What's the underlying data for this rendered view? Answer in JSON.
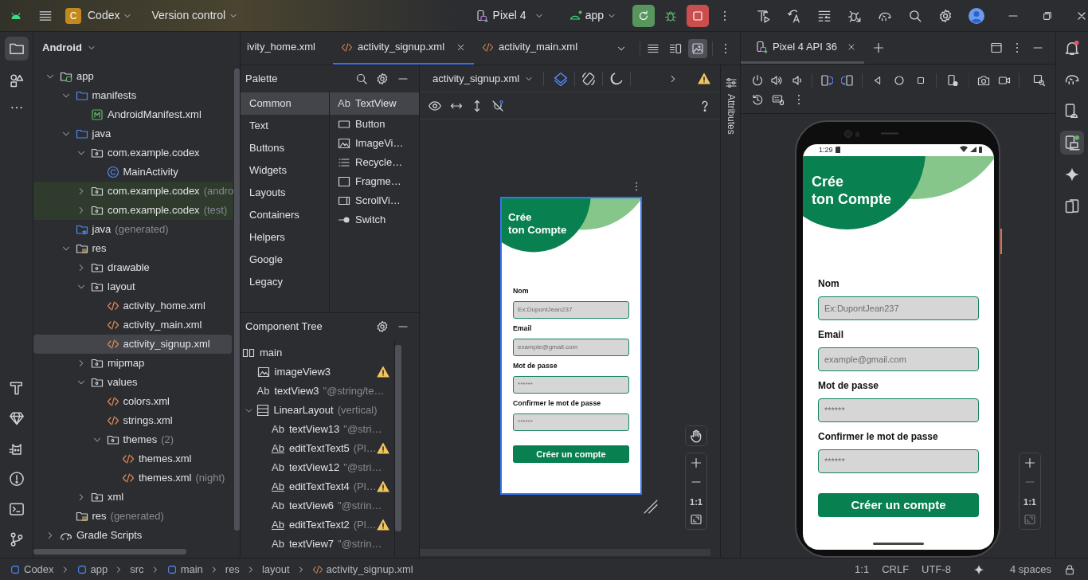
{
  "toolbar": {
    "project_initial": "C",
    "project_name": "Codex",
    "vcs": "Version control",
    "device": "Pixel 4",
    "run_config": "app"
  },
  "left_tools": [
    {
      "kind": "project",
      "selected": true
    },
    {
      "kind": "structure",
      "selected": false
    }
  ],
  "project_panel": {
    "view": "Android",
    "tree": [
      {
        "label": "app",
        "kind": "module",
        "expanded": true,
        "selected": false,
        "children": [
          {
            "label": "manifests",
            "kind": "folder",
            "expanded": true,
            "selected": false,
            "children": [
              {
                "label": "AndroidManifest.xml",
                "kind": "manifest",
                "selected": false
              }
            ]
          },
          {
            "label": "java",
            "kind": "folder",
            "expanded": true,
            "selected": false,
            "children": [
              {
                "label": "com.example.codex",
                "kind": "package",
                "expanded": true,
                "selected": false,
                "children": [
                  {
                    "label": "MainActivity",
                    "kind": "class",
                    "selected": false
                  }
                ]
              },
              {
                "label": "com.example.codex",
                "note": "(andro",
                "kind": "test-package",
                "expanded": false,
                "selected": false
              },
              {
                "label": "com.example.codex",
                "note": "(test)",
                "kind": "test-package",
                "expanded": false,
                "selected": false
              }
            ]
          },
          {
            "label": "java",
            "note": "(generated)",
            "kind": "gen-folder",
            "selected": false
          },
          {
            "label": "res",
            "kind": "res-folder",
            "expanded": true,
            "selected": false,
            "children": [
              {
                "label": "drawable",
                "kind": "dir",
                "expanded": false,
                "selected": false
              },
              {
                "label": "layout",
                "kind": "dir",
                "expanded": true,
                "selected": false,
                "children": [
                  {
                    "label": "activity_home.xml",
                    "kind": "xml",
                    "selected": false
                  },
                  {
                    "label": "activity_main.xml",
                    "kind": "xml",
                    "selected": false
                  },
                  {
                    "label": "activity_signup.xml",
                    "kind": "xml",
                    "selected": true
                  }
                ]
              },
              {
                "label": "mipmap",
                "kind": "dir",
                "expanded": false,
                "selected": false
              },
              {
                "label": "values",
                "kind": "dir",
                "expanded": true,
                "selected": false,
                "children": [
                  {
                    "label": "colors.xml",
                    "kind": "xml",
                    "selected": false
                  },
                  {
                    "label": "strings.xml",
                    "kind": "xml",
                    "selected": false
                  },
                  {
                    "label": "themes",
                    "note": "(2)",
                    "kind": "dir",
                    "expanded": true,
                    "selected": false,
                    "children": [
                      {
                        "label": "themes.xml",
                        "kind": "xml",
                        "selected": false
                      },
                      {
                        "label": "themes.xml",
                        "note": "(night)",
                        "kind": "xml",
                        "selected": false
                      }
                    ]
                  }
                ]
              },
              {
                "label": "xml",
                "kind": "dir",
                "expanded": false,
                "selected": false
              }
            ]
          },
          {
            "label": "res",
            "note": "(generated)",
            "kind": "res-folder",
            "selected": false
          }
        ]
      },
      {
        "label": "Gradle Scripts",
        "kind": "gradle",
        "expanded": false,
        "selected": false
      }
    ]
  },
  "editor_tabs": [
    {
      "label": "ivity_home.xml",
      "selected": false
    },
    {
      "label": "activity_signup.xml",
      "selected": true
    },
    {
      "label": "activity_main.xml",
      "selected": false
    }
  ],
  "view_modes": [
    {
      "kind": "code",
      "selected": false
    },
    {
      "kind": "split",
      "selected": false
    },
    {
      "kind": "design",
      "selected": true
    }
  ],
  "palette": {
    "title": "Palette",
    "categories": [
      {
        "label": "Common",
        "selected": true
      },
      {
        "label": "Text",
        "selected": false
      },
      {
        "label": "Buttons",
        "selected": false
      },
      {
        "label": "Widgets",
        "selected": false
      },
      {
        "label": "Layouts",
        "selected": false
      },
      {
        "label": "Containers",
        "selected": false
      },
      {
        "label": "Helpers",
        "selected": false
      },
      {
        "label": "Google",
        "selected": false
      },
      {
        "label": "Legacy",
        "selected": false
      }
    ],
    "widgets": [
      {
        "label": "TextView",
        "kind": "text",
        "glyph": "Ab",
        "selected": true
      },
      {
        "label": "Button",
        "kind": "button",
        "selected": false
      },
      {
        "label": "ImageVi…",
        "kind": "image",
        "selected": false
      },
      {
        "label": "Recycle…",
        "kind": "list",
        "selected": false
      },
      {
        "label": "Fragme…",
        "kind": "fragment",
        "selected": false
      },
      {
        "label": "ScrollVi…",
        "kind": "scroll",
        "selected": false
      },
      {
        "label": "Switch",
        "kind": "switch",
        "selected": false
      }
    ]
  },
  "component_tree": {
    "title": "Component Tree",
    "items": [
      {
        "label": "main",
        "kind": "constraint",
        "warning": false,
        "children": [
          {
            "label": "imageView3",
            "kind": "image",
            "warning": true
          },
          {
            "label": "textView3",
            "kind": "text",
            "glyph": "Ab",
            "hint": "\"@string/te…",
            "warning": false
          },
          {
            "label": "LinearLayout",
            "kind": "linear",
            "hint": "(vertical)",
            "warning": false,
            "expanded": true,
            "children": [
              {
                "label": "textView13",
                "kind": "text",
                "glyph": "Ab",
                "hint": "\"@stri…",
                "warning": false
              },
              {
                "label": "editTextText5",
                "kind": "edit",
                "glyph": "Ab",
                "hint": "(Pl…",
                "warning": true
              },
              {
                "label": "textView12",
                "kind": "text",
                "glyph": "Ab",
                "hint": "\"@stri…",
                "warning": false
              },
              {
                "label": "editTextText4",
                "kind": "edit",
                "glyph": "Ab",
                "hint": "(Pl…",
                "warning": true
              },
              {
                "label": "textView6",
                "kind": "text",
                "glyph": "Ab",
                "hint": "\"@strin…",
                "warning": false
              },
              {
                "label": "editTextText2",
                "kind": "edit",
                "glyph": "Ab",
                "hint": "(Pl…",
                "warning": true
              },
              {
                "label": "textView7",
                "kind": "text",
                "glyph": "Ab",
                "hint": "\"@strin…",
                "warning": false
              }
            ]
          }
        ]
      }
    ]
  },
  "design": {
    "file": "activity_signup.xml",
    "side_label": "Attributes",
    "zoom_label": "1:1",
    "preview": {
      "selected": true,
      "title": "Crée\nton Compte",
      "fields": [
        {
          "label": "Nom",
          "placeholder": "Ex:DupontJean237"
        },
        {
          "label": "Email",
          "placeholder": "example@gmail.com"
        },
        {
          "label": "Mot de passe",
          "placeholder": "******"
        },
        {
          "label": "Confirmer le mot de passe",
          "placeholder": "******"
        }
      ],
      "button": "Créer un compte"
    }
  },
  "running_devices": {
    "tab": "Pixel 4 API 36",
    "zoom_label": "1:1",
    "screen": {
      "status_time": "1:29",
      "title": "Crée\nton Compte",
      "fields": [
        {
          "label": "Nom",
          "placeholder": "Ex:DupontJean237"
        },
        {
          "label": "Email",
          "placeholder": "example@gmail.com"
        },
        {
          "label": "Mot de passe",
          "placeholder": "******"
        },
        {
          "label": "Confirmer le mot de passe",
          "placeholder": "******"
        }
      ],
      "button": "Créer un compte"
    }
  },
  "right_tools": [
    {
      "kind": "gradle",
      "selected": false
    },
    {
      "kind": "device-manager",
      "selected": false
    },
    {
      "kind": "running-devices",
      "selected": true
    },
    {
      "kind": "assistant",
      "selected": false
    },
    {
      "kind": "mirroring",
      "selected": false
    }
  ],
  "status_bar": {
    "path": [
      {
        "label": "Codex",
        "kind": "module"
      },
      {
        "label": "app",
        "kind": "module"
      },
      {
        "label": "src",
        "kind": "dir"
      },
      {
        "label": "main",
        "kind": "module"
      },
      {
        "label": "res",
        "kind": "dir"
      },
      {
        "label": "layout",
        "kind": "dir"
      },
      {
        "label": "activity_signup.xml",
        "kind": "xml"
      }
    ],
    "position": "1:1",
    "line_separator": "CRLF",
    "encoding": "UTF-8",
    "indent": "4 spaces"
  }
}
